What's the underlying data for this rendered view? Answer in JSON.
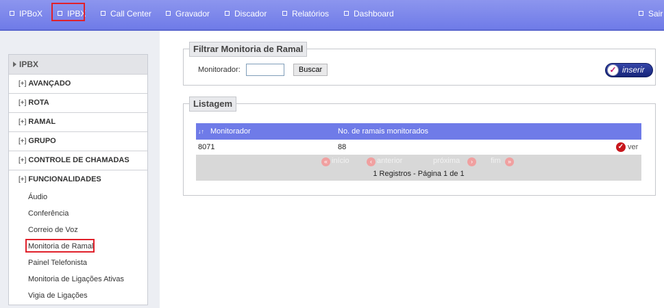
{
  "nav": {
    "items": [
      "IPBoX",
      "IPBX",
      "Call Center",
      "Gravador",
      "Discador",
      "Relatórios",
      "Dashboard"
    ],
    "logout": "Sair"
  },
  "sidebar": {
    "header": "IPBX",
    "sections": [
      "AVANÇADO",
      "ROTA",
      "RAMAL",
      "GRUPO",
      "CONTROLE DE CHAMADAS",
      "FUNCIONALIDADES"
    ],
    "plus": "[+]",
    "sub_items": [
      "Áudio",
      "Conferência",
      "Correio de Voz",
      "Monitoria de Ramal",
      "Painel Telefonista",
      "Monitoria de Ligações Ativas",
      "Vigia de Ligações"
    ]
  },
  "filter": {
    "legend": "Filtrar Monitoria de Ramal",
    "label": "Monitorador:",
    "value": "",
    "search_button": "Buscar",
    "insert_button": "inserir"
  },
  "listing": {
    "legend": "Listagem",
    "columns": [
      "Monitorador",
      "No. de ramais monitorados"
    ],
    "rows": [
      {
        "monitorador": "8071",
        "ramais": "88",
        "action": "ver"
      }
    ],
    "pager": {
      "first": "início",
      "prev": "anterior",
      "next": "próxima",
      "last": "fim",
      "info": "1 Registros - Página 1 de 1"
    }
  },
  "colors": {
    "nav_bg": "#7a85ea",
    "table_header": "#6f7be8",
    "highlight": "#e0202a"
  }
}
